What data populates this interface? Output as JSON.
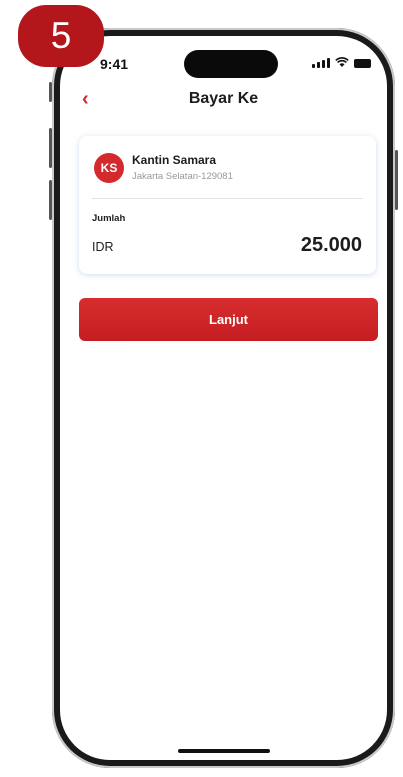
{
  "status_bar": {
    "time": "9:41"
  },
  "header": {
    "back_icon": "chevron-left-icon",
    "title": "Bayar Ke"
  },
  "merchant": {
    "initials": "KS",
    "name": "Kantin Samara",
    "location": "Jakarta Selatan-129081"
  },
  "payment": {
    "amount_label": "Jumlah",
    "currency": "IDR",
    "amount": "25.000"
  },
  "actions": {
    "continue_label": "Lanjut"
  },
  "step": {
    "number": "5"
  },
  "colors": {
    "brand_red": "#d42a2d",
    "badge_red": "#b3171b"
  }
}
